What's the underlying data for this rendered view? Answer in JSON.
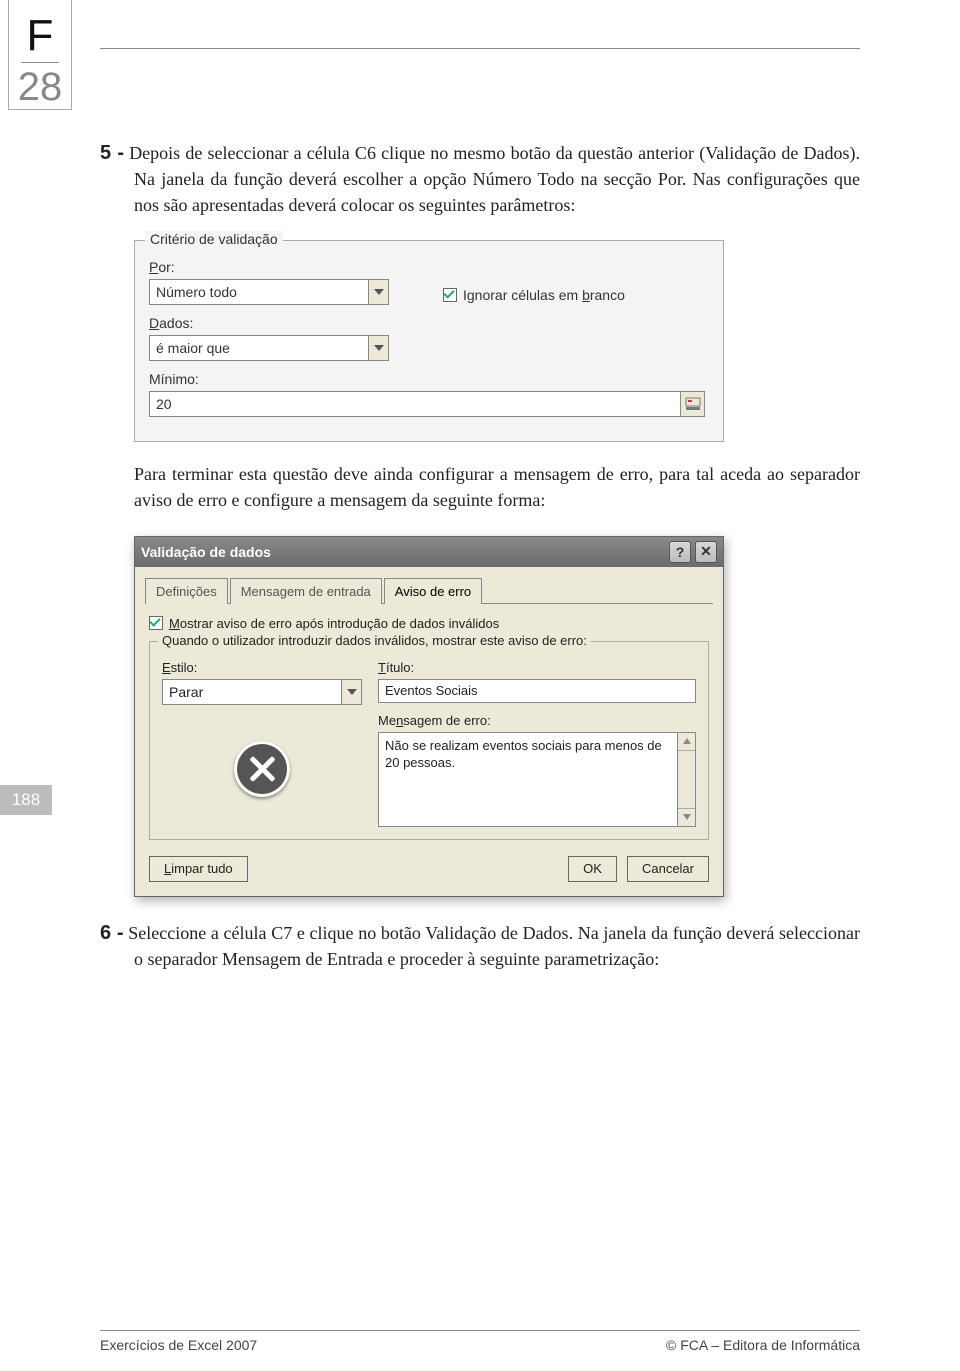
{
  "tab_letter": "F",
  "tab_number": "28",
  "side_badge": "188",
  "para5": {
    "bullet": "5 -",
    "text": "Depois de seleccionar a célula C6 clique no mesmo botão da questão anterior (Validação de Dados). Na janela da função deverá escolher a opção Número Todo na secção Por. Nas configurações que nos são apresentadas deverá colocar os seguintes parâmetros:"
  },
  "fieldset1": {
    "legend": "Critério de validação",
    "por_label_pre": "P",
    "por_label_post": "or:",
    "por_value": "Número todo",
    "ignorar_pre": "Ignorar células em ",
    "ignorar_u": "b",
    "ignorar_post": "ranco",
    "dados_label_u": "D",
    "dados_label_post": "ados:",
    "dados_value": "é maior que",
    "minimo_label": "Mínimo:",
    "minimo_value": "20"
  },
  "para_between": "Para terminar esta questão deve ainda configurar a mensagem de erro, para tal aceda ao separador aviso de erro e configure a mensagem da seguinte forma:",
  "dialog2": {
    "title": "Validação de dados",
    "help": "?",
    "close": "✕",
    "tab1": "Definições",
    "tab2": "Mensagem de entrada",
    "tab3": "Aviso de erro",
    "chk_label_u": "M",
    "chk_label_post": "ostrar aviso de erro após introdução de dados inválidos",
    "fieldset_legend": "Quando o utilizador introduzir dados inválidos, mostrar este aviso de erro:",
    "estilo_u": "E",
    "estilo_post": "stilo:",
    "estilo_value": "Parar",
    "titulo_u": "T",
    "titulo_post": "ítulo:",
    "titulo_value": "Eventos Sociais",
    "msg_label_pre": "Me",
    "msg_label_u": "n",
    "msg_label_post": "sagem de erro:",
    "msg_value": "Não se realizam eventos sociais para menos de 20 pessoas.",
    "btn_limpar_u": "L",
    "btn_limpar_post": "impar tudo",
    "btn_ok": "OK",
    "btn_cancel": "Cancelar"
  },
  "para6": {
    "bullet": "6 -",
    "text": "Seleccione a célula C7 e clique no botão Validação de Dados. Na janela da função deverá seleccionar o separador Mensagem de Entrada e proceder à seguinte parametrização:"
  },
  "footer": {
    "left": "Exercícios de Excel 2007",
    "right": "© FCA – Editora de Informática"
  }
}
